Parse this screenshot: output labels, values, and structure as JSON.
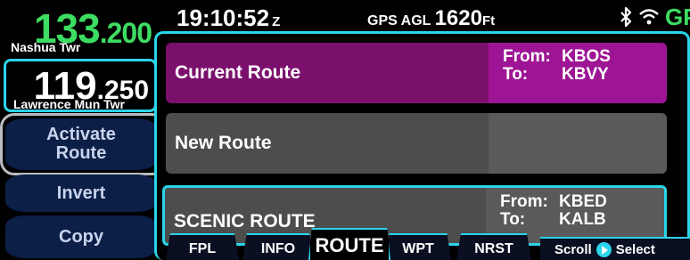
{
  "com": {
    "active": {
      "mhz": "133",
      "khz": ".200",
      "facility": "Nashua Twr"
    },
    "standby": {
      "mhz": "119",
      "khz": ".250",
      "facility": "Lawrence Mun Twr"
    }
  },
  "softkeys": {
    "activate_line1": "Activate",
    "activate_line2": "Route",
    "invert": "Invert",
    "copy": "Copy"
  },
  "status": {
    "time": "19:10:52",
    "time_suffix": "Z",
    "agl_prefix": "GPS AGL",
    "agl_value": "1620",
    "agl_unit": "Ft",
    "gps": "GPS",
    "icons": [
      "bluetooth-icon",
      "wifi-icon"
    ]
  },
  "routes": [
    {
      "name": "Current Route",
      "from_label": "From:",
      "from": "KBOS",
      "to_label": "To:",
      "to": "KBVY",
      "color": "#7b106c"
    },
    {
      "name": "New Route"
    },
    {
      "name": "SCENIC ROUTE",
      "from_label": "From:",
      "from": "KBED",
      "to_label": "To:",
      "to": "KALB"
    }
  ],
  "tabs": [
    "FPL",
    "INFO",
    "ROUTE",
    "WPT",
    "NRST"
  ],
  "active_tab": "ROUTE",
  "hint": {
    "scroll": "Scroll",
    "select": "Select"
  },
  "colors": {
    "green": "#3ddc62",
    "cyan": "#2ad4ea",
    "magenta": "#9d1594"
  }
}
